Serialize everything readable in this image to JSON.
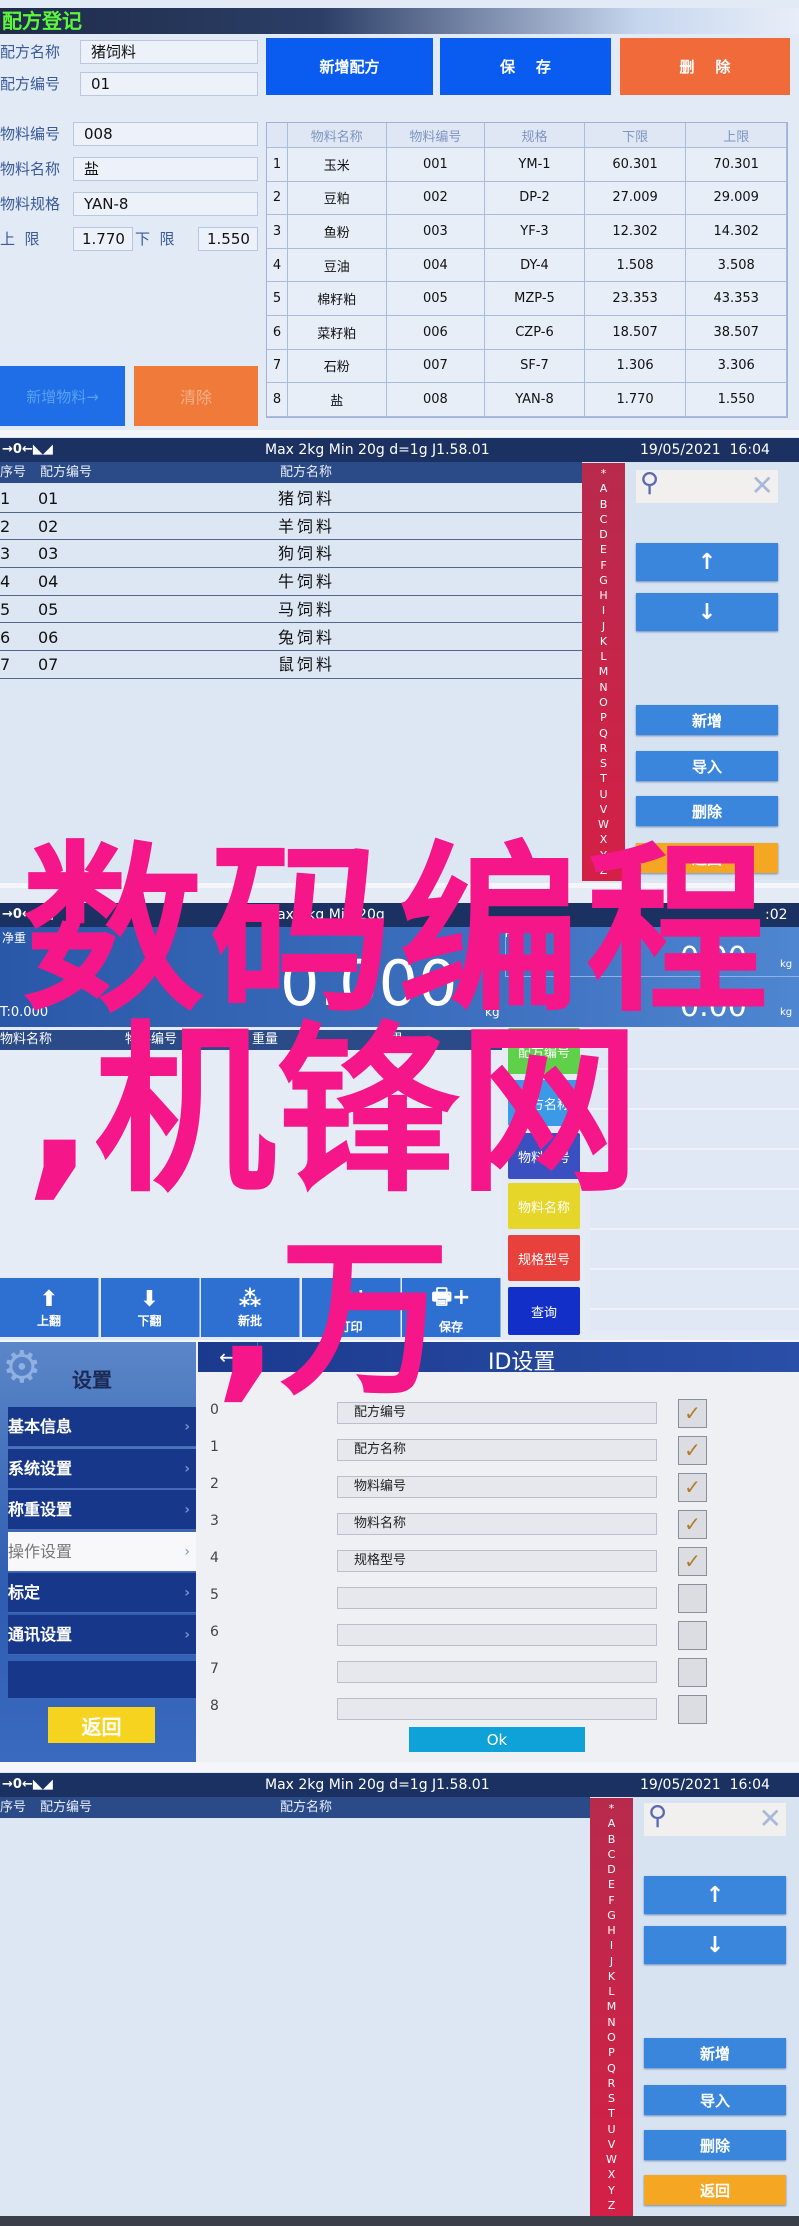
{
  "recipe_register": {
    "title": "配方登记",
    "recipe_name_label": "配方名称",
    "recipe_name_value": "猪饲料",
    "recipe_code_label": "配方编号",
    "recipe_code_value": "01",
    "material_code_label": "物料编号",
    "material_code_value": "008",
    "material_name_label": "物料名称",
    "material_name_value": "盐",
    "material_spec_label": "物料规格",
    "material_spec_value": "YAN-8",
    "upper_label": "上  限",
    "upper_value": "1.770",
    "lower_label": "下  限",
    "lower_value": "1.550",
    "new_recipe": "新增配方",
    "save": "保    存",
    "delete": "删    除",
    "add_material": "新增物料→",
    "clear": "清除",
    "columns": [
      "",
      "物料名称",
      "物料编号",
      "规格",
      "下限",
      "上限"
    ],
    "rows": [
      [
        "1",
        "玉米",
        "001",
        "YM-1",
        "60.301",
        "70.301"
      ],
      [
        "2",
        "豆粕",
        "002",
        "DP-2",
        "27.009",
        "29.009"
      ],
      [
        "3",
        "鱼粉",
        "003",
        "YF-3",
        "12.302",
        "14.302"
      ],
      [
        "4",
        "豆油",
        "004",
        "DY-4",
        "1.508",
        "3.508"
      ],
      [
        "5",
        "棉籽粕",
        "005",
        "MZP-5",
        "23.353",
        "43.353"
      ],
      [
        "6",
        "菜籽粕",
        "006",
        "CZP-6",
        "18.507",
        "38.507"
      ],
      [
        "7",
        "石粉",
        "007",
        "SF-7",
        "1.306",
        "3.306"
      ],
      [
        "8",
        "盐",
        "008",
        "YAN-8",
        "1.770",
        "1.550"
      ]
    ],
    "colors": {
      "blue": "#0a5cf0",
      "orange": "#f06a3a",
      "title_green": "#5cf53a"
    }
  },
  "recipe_list_1": {
    "status_icons": "→0←◣◢",
    "spec": "Max 2kg  Min 20g  d=1g    J1.58.01",
    "datetime": "19/05/2021  16:04",
    "columns": [
      "序号",
      "配方编号",
      "配方名称"
    ],
    "rows": [
      [
        "1",
        "01",
        "猪饲料"
      ],
      [
        "2",
        "02",
        "羊饲料"
      ],
      [
        "3",
        "03",
        "狗饲料"
      ],
      [
        "4",
        "04",
        "牛饲料"
      ],
      [
        "5",
        "05",
        "马饲料"
      ],
      [
        "6",
        "06",
        "兔饲料"
      ],
      [
        "7",
        "07",
        "鼠饲料"
      ]
    ],
    "buttons": {
      "new": "新增",
      "import": "导入",
      "delete": "删除",
      "back": "返回"
    }
  },
  "alphabet": [
    "*",
    "A",
    "B",
    "C",
    "D",
    "E",
    "F",
    "G",
    "H",
    "I",
    "J",
    "K",
    "L",
    "M",
    "N",
    "O",
    "P",
    "Q",
    "R",
    "S",
    "T",
    "U",
    "V",
    "W",
    "X",
    "Y",
    "Z"
  ],
  "weighing": {
    "status_icons": "→0←◣◢",
    "spec": "Max 2kg  Min 20g",
    "time_fragment": ":02",
    "net_label": "净重",
    "net_value": "0.000",
    "tare": "T:0.000",
    "unit": "kg",
    "hi_label": "Hi",
    "hi_value": "0.00",
    "lo_value": "0.00",
    "columns": [
      "物料名称",
      "物料编号",
      "重量",
      "结果"
    ],
    "side_buttons": [
      {
        "label": "配方编号",
        "color": "#5fd04a"
      },
      {
        "label": "配方名称",
        "color": "#3a9ae8"
      },
      {
        "label": "物料编号",
        "color": "#3a4fc0"
      },
      {
        "label": "物料名称",
        "color": "#e6d62a"
      },
      {
        "label": "规格型号",
        "color": "#e8403a"
      },
      {
        "label": "查询",
        "color": "#1230c8"
      }
    ],
    "toolbar": [
      {
        "label": "上翻",
        "icon": "arrow-up-icon",
        "glyph": "⬆"
      },
      {
        "label": "下翻",
        "icon": "arrow-down-icon",
        "glyph": "⬇"
      },
      {
        "label": "新批",
        "icon": "batch-icon",
        "glyph": "⁂"
      },
      {
        "label": "打印",
        "icon": "printer-icon",
        "glyph": "🖶+"
      },
      {
        "label": "保存",
        "icon": "save-icon",
        "glyph": "🖶+"
      }
    ]
  },
  "settings": {
    "title": "设置",
    "menu": [
      "基本信息",
      "系统设置",
      "称重设置",
      "操作设置",
      "标定",
      "通讯设置"
    ],
    "selected": "操作设置",
    "back": "返回",
    "page_title": "ID设置",
    "ok": "Ok",
    "rows": [
      {
        "n": "0",
        "value": "配方编号",
        "checked": true
      },
      {
        "n": "1",
        "value": "配方名称",
        "checked": true
      },
      {
        "n": "2",
        "value": "物料编号",
        "checked": true
      },
      {
        "n": "3",
        "value": "物料名称",
        "checked": true
      },
      {
        "n": "4",
        "value": "规格型号",
        "checked": true
      },
      {
        "n": "5",
        "value": "",
        "checked": false
      },
      {
        "n": "6",
        "value": "",
        "checked": false
      },
      {
        "n": "7",
        "value": "",
        "checked": false
      },
      {
        "n": "8",
        "value": "",
        "checked": false
      }
    ]
  },
  "recipe_list_2": {
    "status_icons": "→0←◣◢",
    "spec": "Max 2kg  Min 20g  d=1g    J1.58.01",
    "datetime": "19/05/2021  16:04",
    "columns": [
      "序号",
      "配方编号",
      "配方名称"
    ],
    "rows": [],
    "buttons": {
      "new": "新增",
      "import": "导入",
      "delete": "删除",
      "back": "返回"
    }
  },
  "overlay": {
    "line1": "数码编程",
    "line2": ",机锋网",
    "line3": ",万",
    "color": "#f5168a"
  }
}
